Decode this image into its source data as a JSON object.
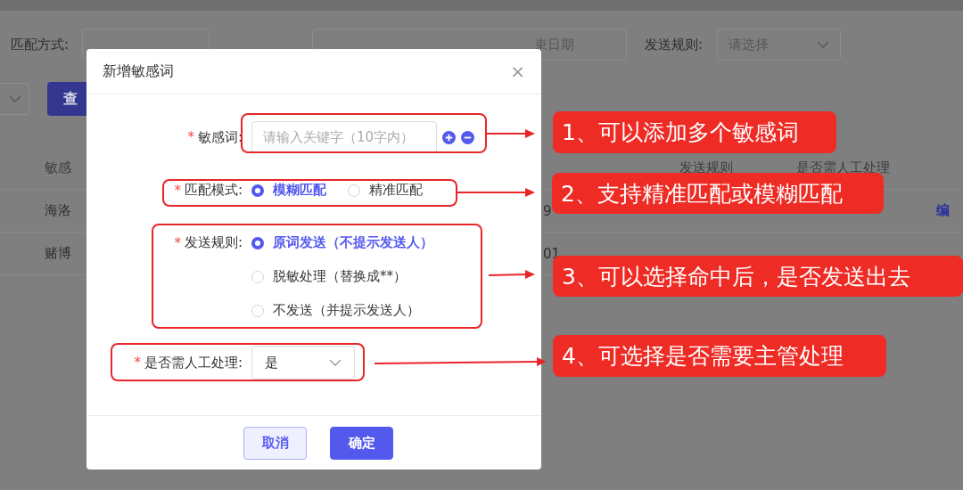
{
  "filter_bar": {
    "match_label": "匹配方式:",
    "date_range_end": "束日期",
    "rule_label": "发送规则:",
    "rule_select": "请选择",
    "query_button": "查"
  },
  "table": {
    "columns": [
      {
        "label": "敏感"
      },
      {
        "label": "发送规则"
      },
      {
        "label": "是否需人工处理"
      }
    ],
    "rows": [
      {
        "word": "海洛",
        "time": "9",
        "action": "编"
      },
      {
        "word": "赌博",
        "time": "01"
      }
    ]
  },
  "dialog": {
    "title": "新增敏感词",
    "close": "×",
    "required_mark": "*",
    "keyword": {
      "label": "敏感词:",
      "required": true,
      "placeholder": "请输入关键字（10字内）"
    },
    "match_mode": {
      "label": "匹配模式:",
      "required": true,
      "options": [
        {
          "label": "模糊匹配",
          "selected": true
        },
        {
          "label": "精准匹配",
          "selected": false
        }
      ]
    },
    "send_rule": {
      "label": "发送规则:",
      "required": true,
      "options": [
        {
          "label": "原词发送（不提示发送人）",
          "selected": true
        },
        {
          "label": "脱敏处理（替换成**）",
          "selected": false
        },
        {
          "label": "不发送（并提示发送人）",
          "selected": false
        }
      ]
    },
    "manual": {
      "label": "是否需人工处理:",
      "required": true,
      "value": "是"
    },
    "buttons": [
      {
        "label": "取消",
        "kind": "secondary"
      },
      {
        "label": "确定",
        "kind": "primary"
      }
    ]
  },
  "annotations": [
    {
      "text": "1、可以添加多个敏感词"
    },
    {
      "text": "2、支持精准匹配或模糊匹配"
    },
    {
      "text": "3、可以选择命中后，是否发送出去"
    },
    {
      "text": "4、可选择是否需要主管处理"
    }
  ]
}
